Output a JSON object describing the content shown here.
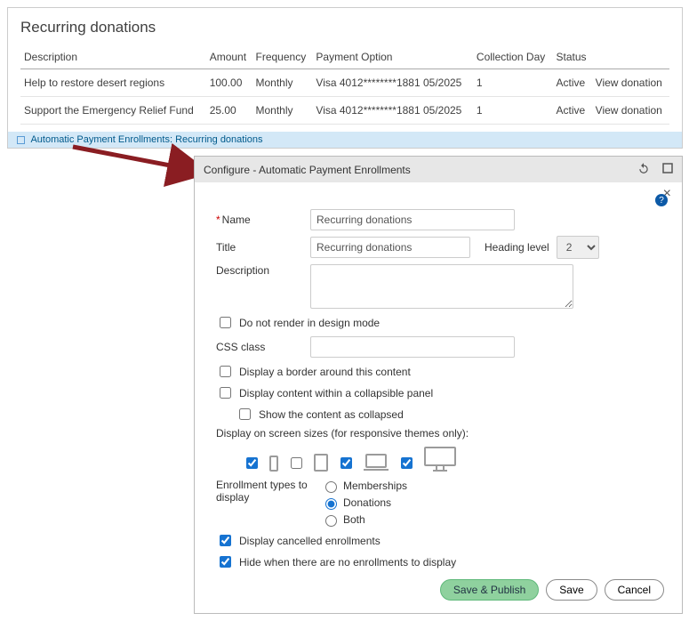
{
  "top": {
    "title": "Recurring donations",
    "cols": [
      "Description",
      "Amount",
      "Frequency",
      "Payment Option",
      "Collection Day",
      "Status",
      ""
    ],
    "rows": [
      {
        "desc": "Help to restore desert regions",
        "amount": "100.00",
        "freq": "Monthly",
        "pay": "Visa 4012********1881 05/2025",
        "day": "1",
        "status": "Active",
        "action": "View donation"
      },
      {
        "desc": "Support the Emergency Relief Fund",
        "amount": "25.00",
        "freq": "Monthly",
        "pay": "Visa 4012********1881 05/2025",
        "day": "1",
        "status": "Active",
        "action": "View donation"
      }
    ],
    "footer": "Automatic Payment Enrollments: Recurring donations"
  },
  "dialog": {
    "title": "Configure - Automatic Payment Enrollments",
    "labels": {
      "name": "Name",
      "title_": "Title",
      "heading": "Heading level",
      "desc": "Description",
      "dnr": "Do not render in design mode",
      "css": "CSS class",
      "border": "Display a border around this content",
      "collapsible": "Display content within a collapsible panel",
      "collapsed": "Show the content as collapsed",
      "screens": "Display on screen sizes (for responsive themes only):",
      "enroll": "Enrollment types to display",
      "opt_mem": "Memberships",
      "opt_don": "Donations",
      "opt_both": "Both",
      "cancelled": "Display cancelled enrollments",
      "hide": "Hide when there are no enrollments to display"
    },
    "values": {
      "name": "Recurring donations",
      "title": "Recurring donations",
      "heading": "2",
      "dnr": false,
      "border": false,
      "collapsible": false,
      "collapsed": false,
      "screen_xs": true,
      "screen_sm": false,
      "screen_md": true,
      "screen_lg": true,
      "enroll": "donations",
      "cancelled": true,
      "hide": true
    },
    "buttons": {
      "publish": "Save & Publish",
      "save": "Save",
      "cancel": "Cancel"
    }
  }
}
